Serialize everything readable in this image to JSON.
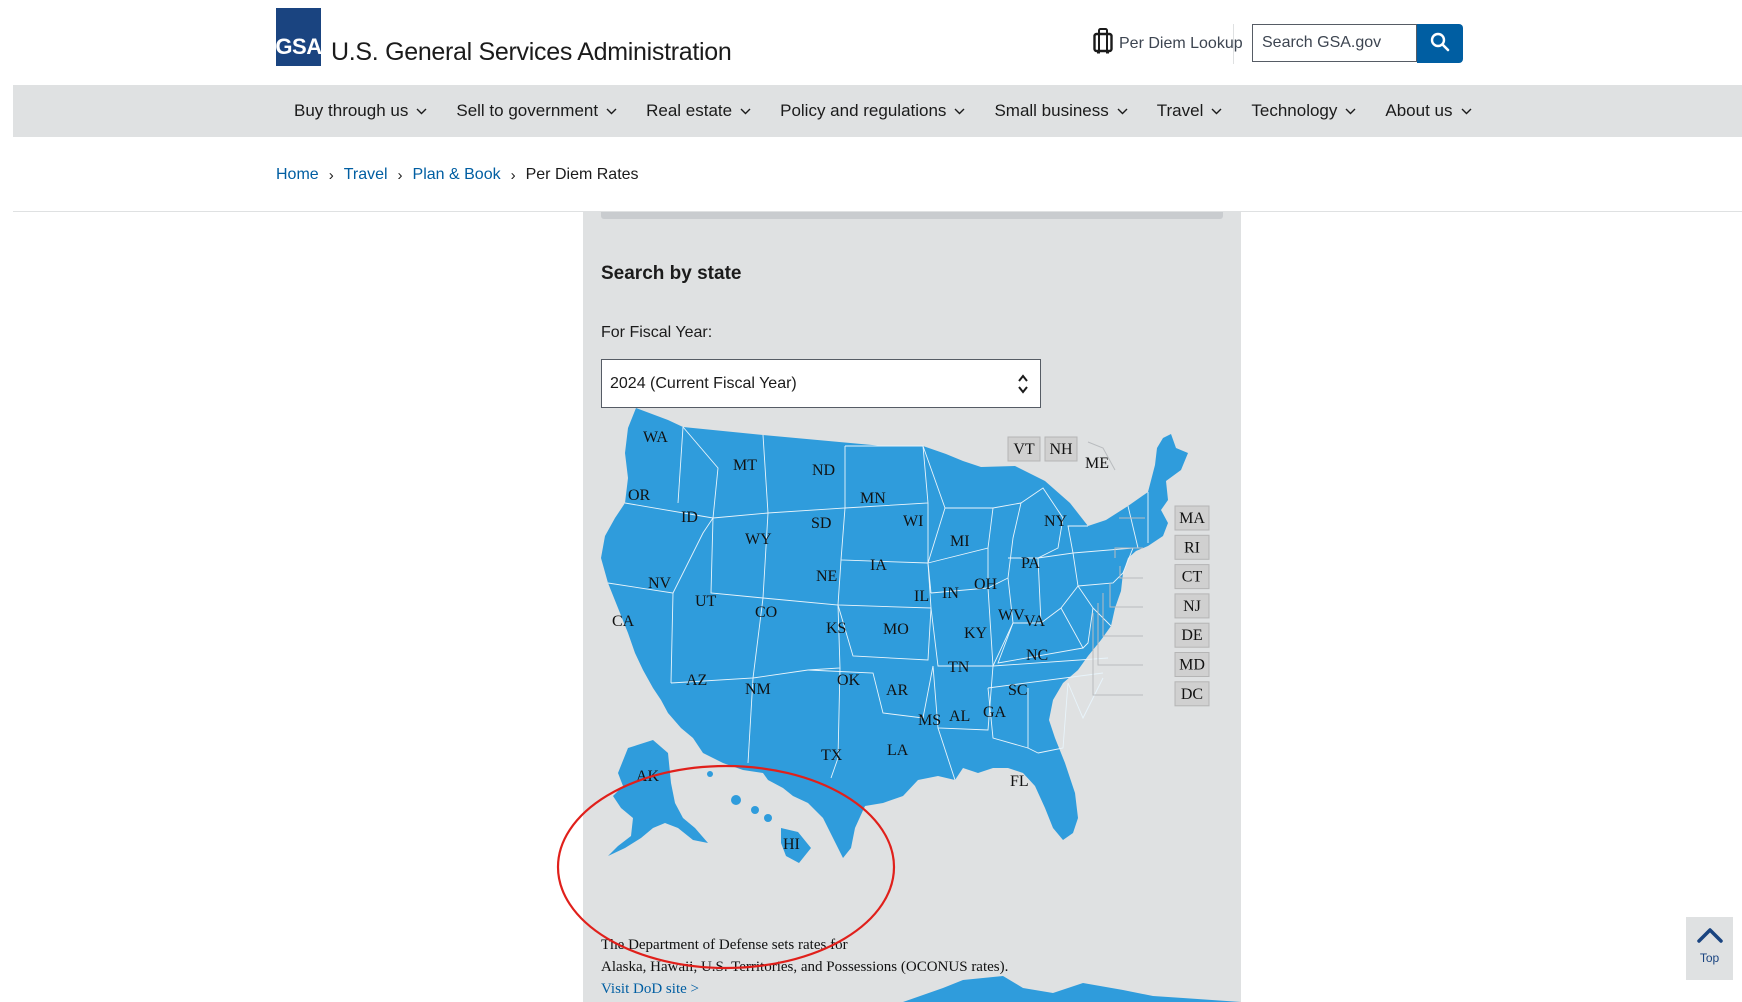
{
  "header": {
    "logo_text": "GSA",
    "agency_name": "U.S. General Services Administration",
    "per_diem_lookup": "Per Diem Lookup",
    "search_placeholder": "Search GSA.gov"
  },
  "nav": {
    "items": [
      {
        "label": "Buy through us"
      },
      {
        "label": "Sell to government"
      },
      {
        "label": "Real estate"
      },
      {
        "label": "Policy and regulations"
      },
      {
        "label": "Small business"
      },
      {
        "label": "Travel"
      },
      {
        "label": "Technology"
      },
      {
        "label": "About us"
      }
    ]
  },
  "breadcrumb": {
    "items": [
      "Home",
      "Travel",
      "Plan & Book"
    ],
    "current": "Per Diem Rates"
  },
  "panel": {
    "title": "Search by state",
    "fiscal_year_label": "For Fiscal Year:",
    "fiscal_year_value": "2024 (Current Fiscal Year)"
  },
  "map": {
    "fill_color": "#2f9cdc",
    "states": [
      "WA",
      "OR",
      "CA",
      "ID",
      "NV",
      "MT",
      "WY",
      "UT",
      "AZ",
      "CO",
      "NM",
      "ND",
      "SD",
      "NE",
      "KS",
      "OK",
      "TX",
      "MN",
      "IA",
      "MO",
      "AR",
      "LA",
      "WI",
      "IL",
      "MI",
      "IN",
      "OH",
      "KY",
      "TN",
      "MS",
      "AL",
      "GA",
      "FL",
      "SC",
      "NC",
      "VA",
      "WV",
      "PA",
      "NY",
      "ME",
      "AK",
      "HI"
    ],
    "small_states_top": [
      "VT",
      "NH"
    ],
    "small_states_side": [
      "MA",
      "RI",
      "CT",
      "NJ",
      "DE",
      "MD",
      "DC"
    ]
  },
  "dod_note": {
    "line1": "The Department of Defense sets rates for",
    "line2": "Alaska, Hawaii, U.S. Territories, and Possessions (OCONUS rates).",
    "link": "Visit DoD site >"
  },
  "back_to_top": {
    "label": "Top"
  },
  "colors": {
    "brand_blue": "#1a4480",
    "link_blue": "#005ea2",
    "nav_bg": "#dfe1e2",
    "annotation_red": "#e0201b"
  }
}
